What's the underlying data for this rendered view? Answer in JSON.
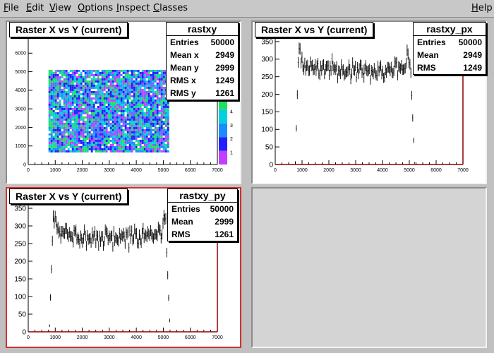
{
  "menu": {
    "items": [
      {
        "label": "File",
        "ul": "F",
        "rest": "ile"
      },
      {
        "label": "Edit",
        "ul": "E",
        "rest": "dit"
      },
      {
        "label": "View",
        "ul": "V",
        "rest": "iew"
      },
      {
        "label": "Options",
        "ul": "O",
        "rest": "ptions"
      },
      {
        "label": "Inspect",
        "ul": "I",
        "rest": "nspect"
      },
      {
        "label": "Classes",
        "ul": "C",
        "rest": "lasses"
      }
    ],
    "help": {
      "label": "Help",
      "ul": "H",
      "rest": "elp"
    }
  },
  "pads": {
    "xy": {
      "title": "Raster X vs Y (current)",
      "stats": {
        "name": "rastxy",
        "rows": [
          {
            "label": "Entries",
            "value": "50000"
          },
          {
            "label": "Mean x",
            "value": "2949"
          },
          {
            "label": "Mean y",
            "value": "2999"
          },
          {
            "label": "RMS x",
            "value": "1249"
          },
          {
            "label": "RMS y",
            "value": "1261"
          }
        ]
      }
    },
    "px": {
      "title": "Raster X vs Y (current)",
      "stats": {
        "name": "rastxy_px",
        "rows": [
          {
            "label": "Entries",
            "value": "50000"
          },
          {
            "label": "Mean",
            "value": "2949"
          },
          {
            "label": "RMS",
            "value": "1249"
          }
        ]
      }
    },
    "py": {
      "title": "Raster X vs Y (current)",
      "stats": {
        "name": "rastxy_py",
        "rows": [
          {
            "label": "Entries",
            "value": "50000"
          },
          {
            "label": "Mean",
            "value": "2999"
          },
          {
            "label": "RMS",
            "value": "1261"
          }
        ]
      }
    }
  },
  "chart_data": [
    {
      "type": "heatmap",
      "name": "rastxy",
      "x_ticks": [
        0,
        1000,
        2000,
        3000,
        4000,
        5000,
        6000,
        7000
      ],
      "y_ticks": [
        0,
        1000,
        2000,
        3000,
        4000,
        5000,
        6000
      ],
      "xlim": [
        0,
        7000
      ],
      "ylim": [
        0,
        7000
      ],
      "filled_region": {
        "x": [
          750,
          5150
        ],
        "y": [
          750,
          5100
        ]
      },
      "palette_ticks": [
        1,
        2,
        3,
        4
      ],
      "colors": [
        "#2020ff",
        "#1a8cff",
        "#00d0e0",
        "#20e060",
        "#c040ff"
      ]
    },
    {
      "type": "line",
      "name": "rastxy_px",
      "x_ticks": [
        0,
        1000,
        2000,
        3000,
        4000,
        5000,
        6000,
        7000
      ],
      "y_ticks": [
        0,
        50,
        100,
        150,
        200,
        250,
        300,
        350
      ],
      "xlim": [
        0,
        7000
      ],
      "ylim": [
        0,
        370
      ],
      "plateau": {
        "x": [
          850,
          5050
        ],
        "level": 275
      },
      "edges": {
        "rise": [
          750,
          850
        ],
        "fall": [
          5050,
          5200
        ]
      }
    },
    {
      "type": "line",
      "name": "rastxy_py",
      "x_ticks": [
        0,
        1000,
        2000,
        3000,
        4000,
        5000,
        6000,
        7000
      ],
      "y_ticks": [
        0,
        50,
        100,
        150,
        200,
        250,
        300,
        350
      ],
      "xlim": [
        0,
        7000
      ],
      "ylim": [
        0,
        370
      ],
      "plateau": {
        "x": [
          900,
          5100
        ],
        "level": 275
      },
      "edges": {
        "rise": [
          780,
          900
        ],
        "fall": [
          5100,
          5250
        ]
      }
    }
  ]
}
